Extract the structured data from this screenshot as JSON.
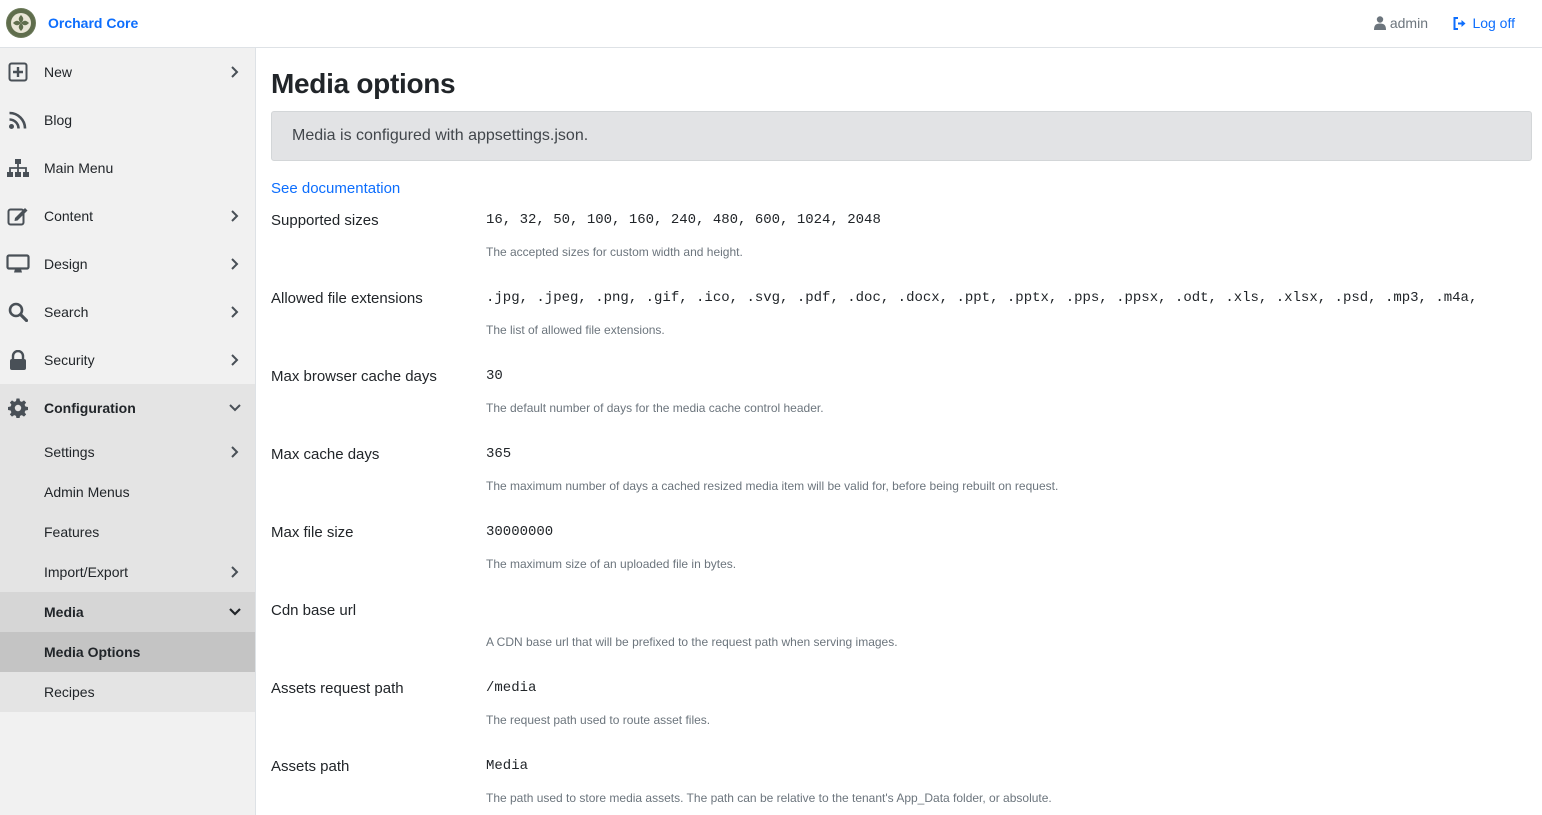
{
  "header": {
    "brand": "Orchard Core",
    "user": "admin",
    "logoff": "Log off"
  },
  "sidebar": {
    "items": [
      {
        "label": "New",
        "icon": "plus-square-icon"
      },
      {
        "label": "Blog",
        "icon": "rss-icon"
      },
      {
        "label": "Main Menu",
        "icon": "sitemap-icon"
      },
      {
        "label": "Content",
        "icon": "edit-icon"
      },
      {
        "label": "Design",
        "icon": "desktop-icon"
      },
      {
        "label": "Search",
        "icon": "search-icon"
      },
      {
        "label": "Security",
        "icon": "lock-icon"
      },
      {
        "label": "Configuration",
        "icon": "gear-icon"
      }
    ],
    "config_sub": [
      {
        "label": "Settings"
      },
      {
        "label": "Admin Menus"
      },
      {
        "label": "Features"
      },
      {
        "label": "Import/Export"
      },
      {
        "label": "Media"
      },
      {
        "label": "Media Options"
      },
      {
        "label": "Recipes"
      }
    ]
  },
  "main": {
    "title": "Media options",
    "alert": "Media is configured with appsettings.json.",
    "doc_link": "See documentation",
    "fields": [
      {
        "label": "Supported sizes",
        "value": "16, 32, 50, 100, 160, 240, 480, 600, 1024, 2048",
        "help": "The accepted sizes for custom width and height."
      },
      {
        "label": "Allowed file extensions",
        "value": ".jpg, .jpeg, .png, .gif, .ico, .svg, .pdf, .doc, .docx, .ppt, .pptx, .pps, .ppsx, .odt, .xls, .xlsx, .psd, .mp3, .m4a,",
        "help": "The list of allowed file extensions."
      },
      {
        "label": "Max browser cache days",
        "value": "30",
        "help": "The default number of days for the media cache control header."
      },
      {
        "label": "Max cache days",
        "value": "365",
        "help": "The maximum number of days a cached resized media item will be valid for, before being rebuilt on request."
      },
      {
        "label": "Max file size",
        "value": "30000000",
        "help": "The maximum size of an uploaded file in bytes."
      },
      {
        "label": "Cdn base url",
        "value": "",
        "help": "A CDN base url that will be prefixed to the request path when serving images."
      },
      {
        "label": "Assets request path",
        "value": "/media",
        "help": "The request path used to route asset files."
      },
      {
        "label": "Assets path",
        "value": "Media",
        "help": "The path used to store media assets. The path can be relative to the tenant's App_Data folder, or absolute."
      }
    ]
  },
  "colors": {
    "accent": "#0d6efd",
    "sidebar_bg": "#f1f1f1",
    "alert_bg": "#e2e3e5"
  }
}
